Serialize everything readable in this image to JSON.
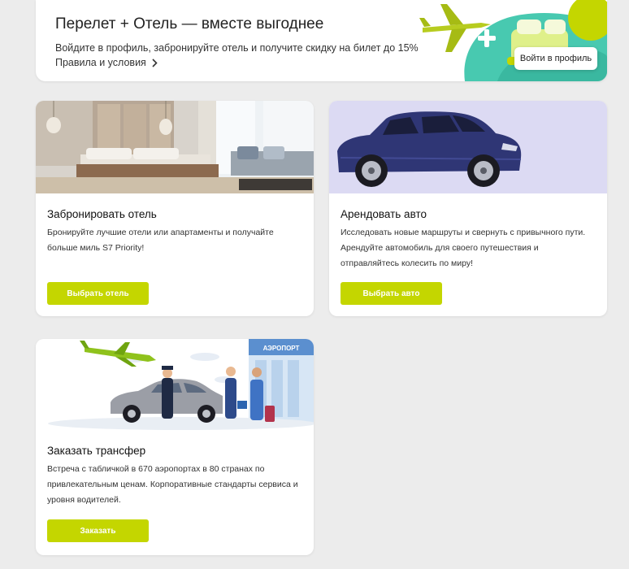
{
  "promo": {
    "title": "Перелет + Отель — вместе выгоднее",
    "subtitle": "Войдите в профиль, забронируйте отель и получите скидку на билет до 15%",
    "rules_link": "Правила и условия",
    "login_button": "Войти в профиль",
    "accent_color": "#c4d600",
    "teal_color": "#48c9b0"
  },
  "cards": {
    "hotel": {
      "title": "Забронировать отель",
      "desc_line1": "Бронируйте лучшие отели или апартаменты и получайте",
      "desc_line2": "больше миль S7 Priority!",
      "button": "Выбрать отель"
    },
    "car": {
      "title": "Арендовать авто",
      "desc_line1": "Исследовать новые маршруты и свернуть с привычного пути.",
      "desc_line2": "Арендуйте автомобиль для своего путешествия и",
      "desc_line3": "отправляйтесь колесить по миру!",
      "button": "Выбрать авто"
    },
    "transfer": {
      "title": "Заказать трансфер",
      "desc_line1": "Встреча с табличкой в 670 аэропортах в 80 странах по",
      "desc_line2": "привлекательным ценам. Корпоративные стандарты сервиса и",
      "desc_line3": "уровня водителей.",
      "button": "Заказать",
      "airport_sign": "АЭРОПОРТ"
    }
  }
}
